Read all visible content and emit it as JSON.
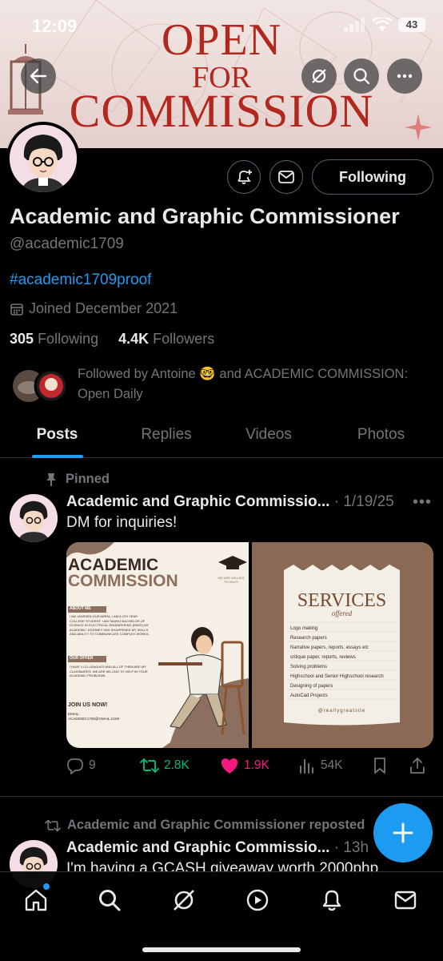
{
  "status_bar": {
    "time": "12:09",
    "battery": "43"
  },
  "banner": {
    "line1": "OPEN",
    "line2": "FOR",
    "line3": "COMMISSION"
  },
  "profile": {
    "name": "Academic and Graphic Commissioner",
    "handle": "@academic1709",
    "bio": "#academic1709proof",
    "joined": "Joined December 2021",
    "following_count": "305",
    "following_label": "Following",
    "followers_count": "4.4K",
    "followers_label": "Followers",
    "followed_by": "Followed by Antoine 🤓 and ACADEMIC COMMISSION: Open Daily",
    "follow_button": "Following"
  },
  "tabs": [
    {
      "label": "Posts"
    },
    {
      "label": "Replies"
    },
    {
      "label": "Videos"
    },
    {
      "label": "Photos"
    }
  ],
  "pinned_post": {
    "pinned_label": "Pinned",
    "author": "Academic and Graphic Commissio...",
    "date": "· 1/19/25",
    "text": "DM for inquiries!",
    "media_left": {
      "title1": "ACADEMIC",
      "title2": "COMMISSION",
      "willing": "WE ARE WILLING TO HELP!",
      "about_label": "ABOUT ME",
      "about_text": "I AM JANSSEN GUEVARRA, I AM A 4TH YEAR COLLEGE STUDENT. I AM TAKING BACHELOR OF SCIENCE IN ELECTRICAL ENGINEERING (BSEE).MY ACADEMIC JOURNEY HAS SHARPENED MY SKILLS AND ABILITY TO COMMUNICATE COMPLEX WORKS.",
      "offer_label": "OUR OFFER",
      "offer_text": "I HAVE 4 CO-LEAGUES AND ALL OF THEM ARE MY CLASSMATES. WE ARE WILLING TO HELP IN YOUR ACADEMIC PROBLEMS.",
      "join": "JOIN US NOW!",
      "email_label": "EMAIL:",
      "email": "ACADEMIC1709@GMAIL.COM"
    },
    "media_right": {
      "title": "SERVICES",
      "subtitle": "offered",
      "items": [
        "Logo making",
        "Research papers",
        "Narrative papers, reports, essays etc",
        "critique paper, reports, reviews",
        "Solving problems",
        "Highschool and Senior Highschool research",
        "Designing of papers",
        "AutoCad Projects"
      ],
      "footer": "@reallygreatsite"
    },
    "replies": "9",
    "reposts": "2.8K",
    "likes": "1.9K",
    "views": "54K"
  },
  "second_post": {
    "repost_label": "Academic and Graphic Commissioner reposted",
    "author": "Academic and Graphic Commissio...",
    "date": "· 13h",
    "text": "I'm having a GCASH giveaway worth 2000php"
  },
  "colors": {
    "accent": "#1d9bf0",
    "repost_green": "#00ba7c",
    "like_pink": "#f91880",
    "banner_red": "#b2281f"
  },
  "icons": [
    "back-arrow-icon",
    "grok-icon",
    "search-icon",
    "more-icon",
    "bell-plus-icon",
    "mail-icon",
    "calendar-icon",
    "pin-icon",
    "reply-icon",
    "repost-icon",
    "heart-icon",
    "views-icon",
    "bookmark-icon",
    "share-icon",
    "plus-icon",
    "home-icon",
    "notifications-icon",
    "video-icon"
  ]
}
